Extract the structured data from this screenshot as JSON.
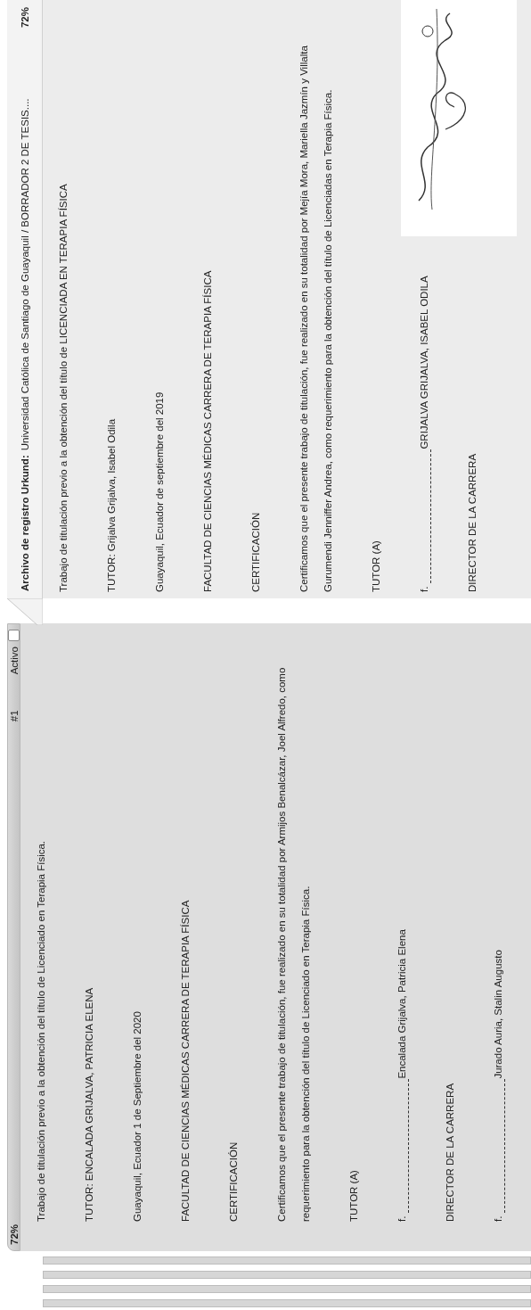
{
  "source_panel": {
    "percent": "72%",
    "match_number": "#1",
    "active_label": "Activo",
    "active": false,
    "paragraphs": [
      {
        "kind": "text",
        "text": "Trabajo de titulación previo a la obtención del título de Licenciado en Terapia Física."
      },
      {
        "kind": "text",
        "text": "TUTOR: ENCALADA GRIJALVA, PATRICIA ELENA"
      },
      {
        "kind": "text",
        "text": "Guayaquil, Ecuador 1 de Septiembre del 2020"
      },
      {
        "kind": "text",
        "text": "FACULTAD DE CIENCIAS MÉDICAS CARRERA DE TERAPIA FÍSICA"
      },
      {
        "kind": "text",
        "text": "CERTIFICACIÓN"
      },
      {
        "kind": "text",
        "text": "Certificamos que el presente trabajo de titulación, fue realizado en su totalidad por Armijos Benalcázar, Joel Alfredo, como requerimiento para la obtención del título de Licenciado en Terapia Física."
      },
      {
        "kind": "text",
        "text": "TUTOR (A)"
      },
      {
        "kind": "signature",
        "prefix": "f.",
        "name": "Encalada Grijalva, Patricia Elena"
      },
      {
        "kind": "text",
        "text": "DIRECTOR DE LA CARRERA"
      },
      {
        "kind": "signature",
        "prefix": "f.",
        "name": "Jurado Auria, Stalin Augusto"
      }
    ]
  },
  "urkund_panel": {
    "label": "Archivo de registro Urkund:",
    "document": "Universidad Católica de Santiago de Guayaquil / BORRADOR 2 DE TESIS....",
    "percent": "72%",
    "paragraphs": [
      {
        "kind": "text",
        "text": "Trabajo de titulación previo a la obtención del título de LICENCIADA EN TERAPIA FÍSICA"
      },
      {
        "kind": "text",
        "text": "TUTOR: Grijalva Grijalva, Isabel  Odila"
      },
      {
        "kind": "text",
        "text": "Guayaquil, Ecuador de septiembre del 2019"
      },
      {
        "kind": "text",
        "text": "FACULTAD DE CIENCIAS MÉDICAS CARRERA DE TERAPIA FÍSICA"
      },
      {
        "kind": "text",
        "text": "CERTIFICACIÓN"
      },
      {
        "kind": "text",
        "text": "Certificamos que el presente trabajo de titulación, fue realizado en su totalidad por Mejía Mora, Mariella Jazmín y Villalta Gurumendi  Jenniffer Andrea, como requerimiento para la obtención del título de Licenciadas en Terapia Física."
      },
      {
        "kind": "text",
        "text": "TUTOR (A)"
      },
      {
        "kind": "signature",
        "prefix": "f.",
        "name": "GRIJALVA GRIJALVA, ISABEL  ODILA"
      },
      {
        "kind": "text",
        "text": "DIRECTOR DE LA CARRERA"
      }
    ]
  }
}
